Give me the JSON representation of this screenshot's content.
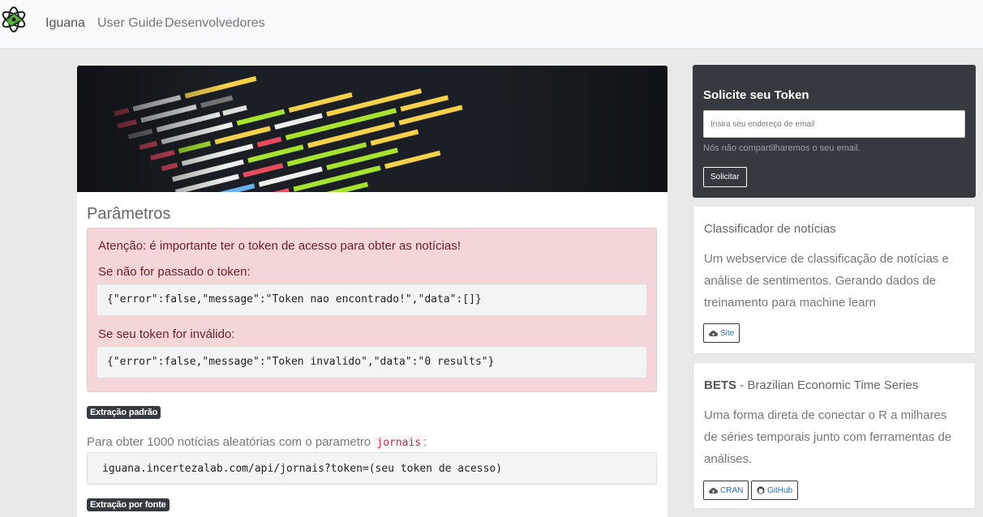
{
  "nav": {
    "brand": "Iguana",
    "links": [
      {
        "label": "User Guide"
      },
      {
        "label": "Desenvolvedores"
      }
    ]
  },
  "main": {
    "section_title": "Parâmetros",
    "alert": {
      "line1": "Atenção: é importante ter o token de acesso para obter as notícias!",
      "line2": "Se não for passado o token:",
      "code1": "{\"error\":false,\"message\":\"Token nao encontrado!\",\"data\":[]}",
      "line3": "Se seu token for inválido:",
      "code2": "{\"error\":false,\"message\":\"Token invalido\",\"data\":\"0 results\"}"
    },
    "badge_default": "Extração padrão",
    "para_prefix": "Para obter 1000 notícias aleatórias com o parametro ",
    "para_code": "jornais",
    "para_suffix": ":",
    "url_example": "iguana.incertezalab.com/api/jornais?token=(seu token de acesso)",
    "badge_source": "Extração por fonte"
  },
  "token_form": {
    "title": "Solicite seu Token",
    "email_placeholder": "Insira seu endereço de email",
    "help": "Nós não compartilharemos o seu email.",
    "button": "Solicitar"
  },
  "cards": [
    {
      "title": "Classificador de notícias",
      "text": "Um webservice de classificação de notícias e análise de sentimentos. Gerando dados de treinamento para machine learn",
      "buttons": [
        {
          "label": "Site",
          "icon": "cloud-download-icon"
        }
      ]
    },
    {
      "title_bold": "BETS",
      "title_rest": " - Brazilian Economic Time Series",
      "text": "Uma forma direta de conectar o R a milhares de séries temporais junto com ferramentas de análises.",
      "buttons": [
        {
          "label": "CRAN",
          "icon": "cloud-download-icon"
        },
        {
          "label": "GitHub",
          "icon": "github-icon"
        }
      ]
    }
  ],
  "colors": {
    "dark": "#343a40",
    "alert_bg": "#f5d6d8",
    "alert_text": "#6b1e26",
    "link": "#2a6fbe",
    "inline_code": "#c7254e"
  }
}
